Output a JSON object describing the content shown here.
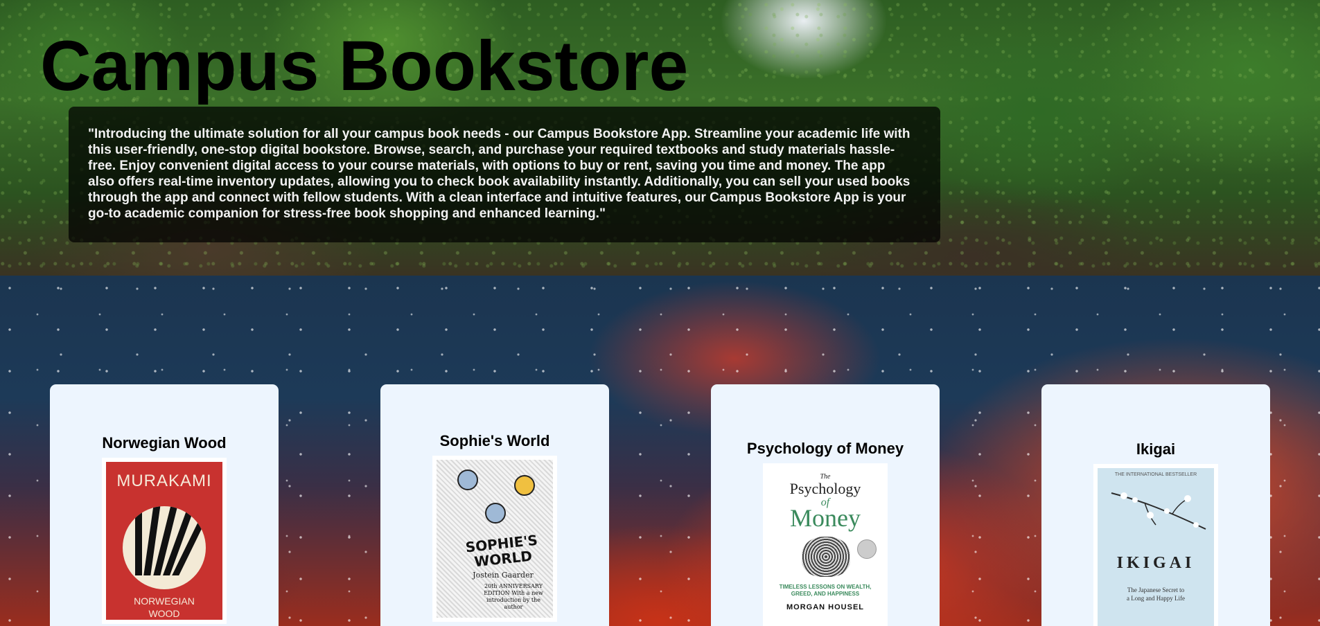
{
  "header": {
    "title": "Campus Bookstore",
    "intro": "\"Introducing the ultimate solution for all your campus book needs - our Campus Bookstore App. Streamline your academic life with this user-friendly, one-stop digital bookstore. Browse, search, and purchase your required textbooks and study materials hassle-free. Enjoy convenient digital access to your course materials, with options to buy or rent, saving you time and money. The app also offers real-time inventory updates, allowing you to check book availability instantly. Additionally, you can sell your used books through the app and connect with fellow students. With a clean interface and intuitive features, our Campus Bookstore App is your go-to academic companion for stress-free book shopping and enhanced learning.\""
  },
  "books": [
    {
      "title": "Norwegian Wood",
      "cover": {
        "author": "MURAKAMI",
        "title_line1": "NORWEGIAN",
        "title_line2": "WOOD",
        "color": "#c8322f"
      }
    },
    {
      "title": "Sophie's World",
      "cover": {
        "title_line1": "SOPHIE'S",
        "title_line2": "WORLD",
        "author": "Jostein Gaarder",
        "edition": "20th ANNIVERSARY EDITION With a new introduction by the author"
      }
    },
    {
      "title": "Psychology of Money",
      "cover": {
        "the": "The",
        "title_line1": "Psychology",
        "of": "of",
        "title_line2": "Money",
        "subtitle": "TIMELESS LESSONS ON WEALTH, GREED, AND HAPPINESS",
        "author": "MORGAN HOUSEL",
        "accent": "#3a8a5c"
      }
    },
    {
      "title": "Ikigai",
      "cover": {
        "banner": "THE INTERNATIONAL BESTSELLER",
        "title": "IKIGAI",
        "subtitle_line1": "The Japanese Secret to",
        "subtitle_line2": "a Long and Happy Life"
      }
    }
  ]
}
